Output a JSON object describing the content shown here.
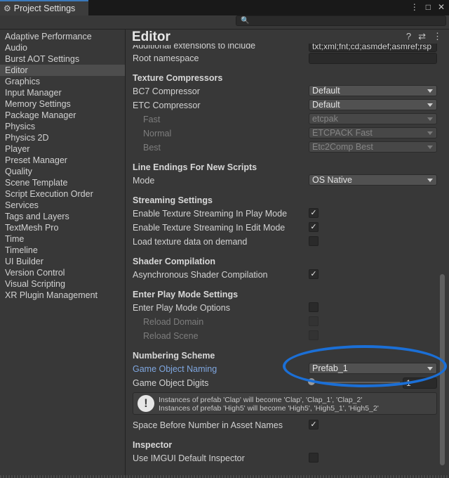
{
  "window": {
    "tab_title": "Project Settings",
    "buttons": [
      "⋮",
      "□",
      "✕"
    ]
  },
  "search": {
    "placeholder": ""
  },
  "sidebar": {
    "items": [
      {
        "label": "Adaptive Performance"
      },
      {
        "label": "Audio"
      },
      {
        "label": "Burst AOT Settings"
      },
      {
        "label": "Editor",
        "selected": true
      },
      {
        "label": "Graphics"
      },
      {
        "label": "Input Manager"
      },
      {
        "label": "Memory Settings"
      },
      {
        "label": "Package Manager"
      },
      {
        "label": "Physics"
      },
      {
        "label": "Physics 2D"
      },
      {
        "label": "Player"
      },
      {
        "label": "Preset Manager"
      },
      {
        "label": "Quality"
      },
      {
        "label": "Scene Template"
      },
      {
        "label": "Script Execution Order"
      },
      {
        "label": "Services"
      },
      {
        "label": "Tags and Layers"
      },
      {
        "label": "TextMesh Pro"
      },
      {
        "label": "Time"
      },
      {
        "label": "Timeline"
      },
      {
        "label": "UI Builder"
      },
      {
        "label": "Version Control"
      },
      {
        "label": "Visual Scripting"
      },
      {
        "label": "XR Plugin Management"
      }
    ]
  },
  "main": {
    "title": "Editor",
    "header_icons": [
      "help-icon",
      "sliders-icon",
      "more-icon"
    ],
    "additional_extensions": {
      "label": "Additional extensions to include",
      "value": "txt;xml;fnt;cd;asmdef;asmref;rsp"
    },
    "root_namespace": {
      "label": "Root namespace",
      "value": ""
    },
    "texture_compressors": {
      "heading": "Texture Compressors",
      "bc7": {
        "label": "BC7 Compressor",
        "value": "Default"
      },
      "etc": {
        "label": "ETC Compressor",
        "value": "Default"
      },
      "fast": {
        "label": "Fast",
        "value": "etcpak"
      },
      "normal": {
        "label": "Normal",
        "value": "ETCPACK Fast"
      },
      "best": {
        "label": "Best",
        "value": "Etc2Comp Best"
      }
    },
    "line_endings": {
      "heading": "Line Endings For New Scripts",
      "mode": {
        "label": "Mode",
        "value": "OS Native"
      }
    },
    "streaming": {
      "heading": "Streaming Settings",
      "play_mode": {
        "label": "Enable Texture Streaming In Play Mode",
        "checked": true
      },
      "edit_mode": {
        "label": "Enable Texture Streaming In Edit Mode",
        "checked": true
      },
      "on_demand": {
        "label": "Load texture data on demand",
        "checked": false
      }
    },
    "shader": {
      "heading": "Shader Compilation",
      "async": {
        "label": "Asynchronous Shader Compilation",
        "checked": true
      }
    },
    "play_mode": {
      "heading": "Enter Play Mode Settings",
      "options": {
        "label": "Enter Play Mode Options",
        "checked": false
      },
      "reload_domain": {
        "label": "Reload Domain",
        "checked": false
      },
      "reload_scene": {
        "label": "Reload Scene",
        "checked": false
      }
    },
    "numbering": {
      "heading": "Numbering Scheme",
      "naming": {
        "label": "Game Object Naming",
        "value": "Prefab_1"
      },
      "digits": {
        "label": "Game Object Digits",
        "value": "1"
      },
      "help_line1": "Instances of prefab 'Clap' will become 'Clap', 'Clap_1', 'Clap_2'",
      "help_line2": "Instances of prefab 'High5' will become 'High5', 'High5_1', 'High5_2'",
      "space_before": {
        "label": "Space Before Number in Asset Names",
        "checked": true
      }
    },
    "inspector": {
      "heading": "Inspector",
      "imgui": {
        "label": "Use IMGUI Default Inspector",
        "checked": false
      }
    }
  },
  "colors": {
    "background": "#383838",
    "accent": "#3a79bb",
    "annotation": "#1b6fd6",
    "link": "#7fa7e0"
  },
  "check_glyph": "✓"
}
